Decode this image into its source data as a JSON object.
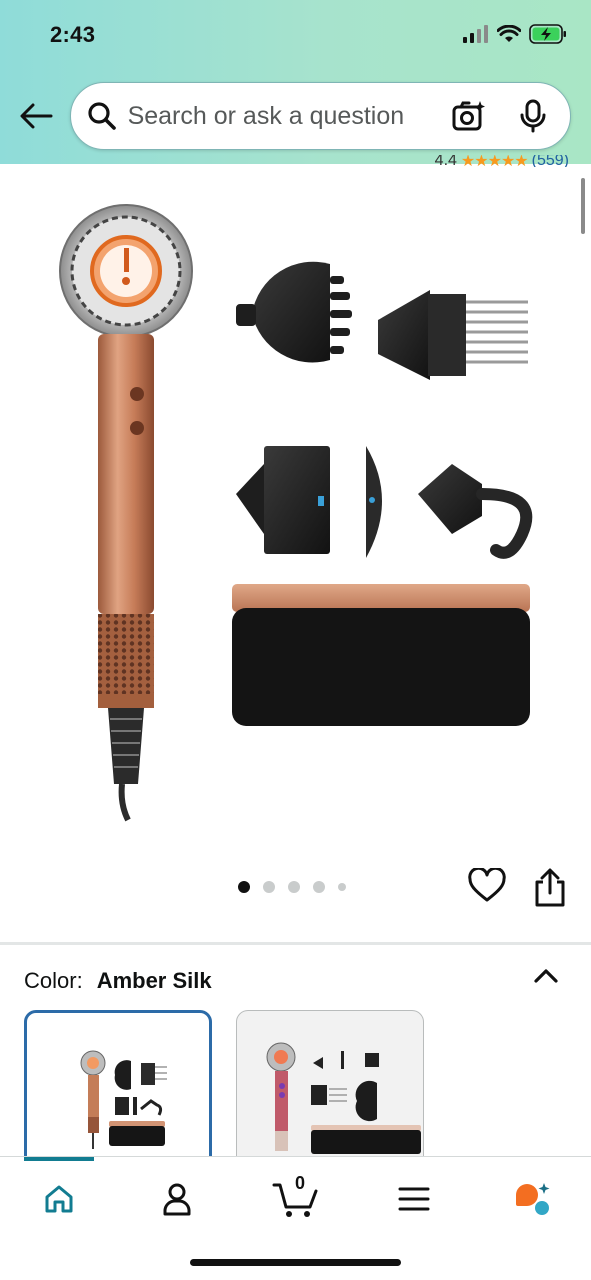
{
  "status_bar": {
    "time": "2:43",
    "icons": [
      "cellular-signal-icon",
      "wifi-icon",
      "battery-charging-icon"
    ]
  },
  "search": {
    "placeholder": "Search or ask a question",
    "value": ""
  },
  "product": {
    "rating_value": "4.4",
    "rating_count": "(559)",
    "gallery": {
      "image_count": 5,
      "active_index": 0
    }
  },
  "color_selector": {
    "label": "Color:",
    "selected": "Amber Silk",
    "options_visible": 2
  },
  "bottom_nav": {
    "items": [
      "home-icon",
      "account-icon",
      "cart-icon",
      "menu-icon",
      "rufus-icon"
    ],
    "active": "home",
    "cart_count": "0"
  },
  "colors": {
    "header_gradient_start": "#8fdcd9",
    "header_gradient_end": "#a9e6c5",
    "accent": "#127c91",
    "selected_border": "#2c6ba8",
    "product_copper": "#c27a55",
    "rating_star": "#f79a1f"
  }
}
